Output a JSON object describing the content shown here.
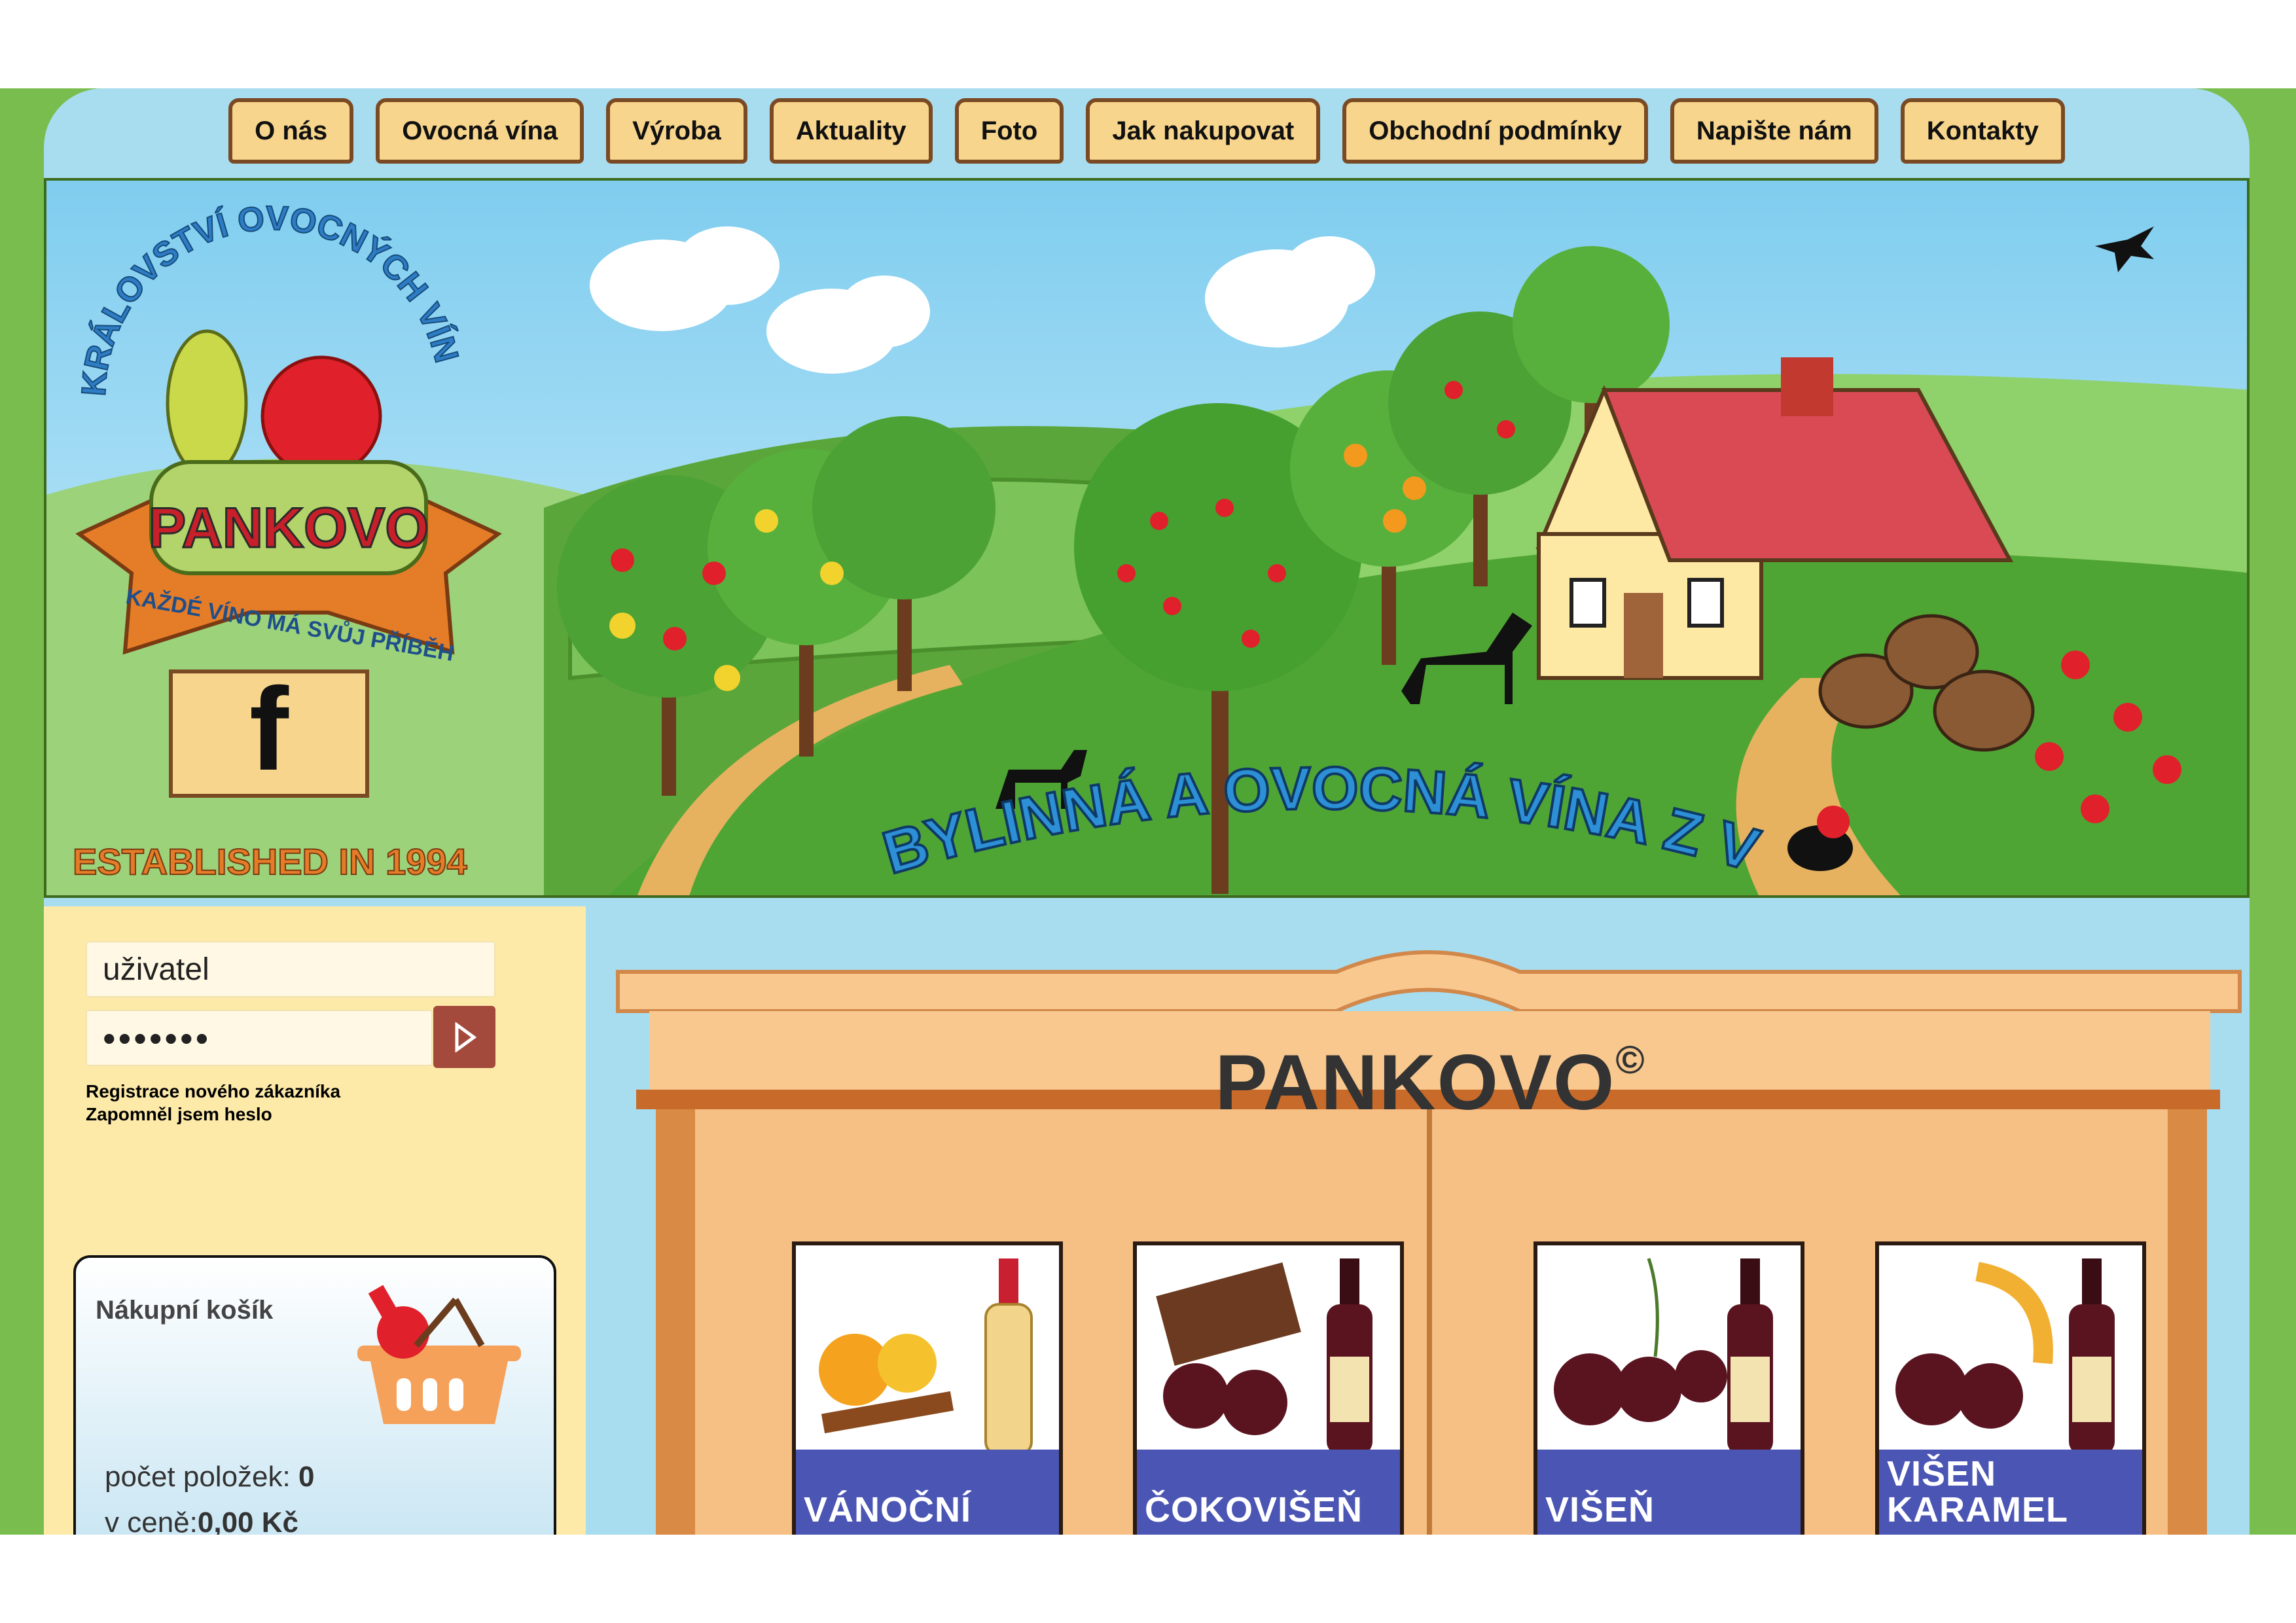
{
  "nav": [
    {
      "label": "O nás"
    },
    {
      "label": "Ovocná vína"
    },
    {
      "label": "Výroba"
    },
    {
      "label": "Aktuality"
    },
    {
      "label": "Foto"
    },
    {
      "label": "Jak nakupovat"
    },
    {
      "label": "Obchodní podmínky"
    },
    {
      "label": "Napište nám"
    },
    {
      "label": "Kontakty"
    }
  ],
  "banner": {
    "logo_arc": "KRÁLOVSTVÍ OVOCNÝCH VÍN",
    "logo_name": "PANKOVO",
    "logo_motto": "KAŽDÉ VÍNO MÁ SVŮJ PŘÍBĚH",
    "established": "ESTABLISHED IN 1994",
    "facebook_icon": "f",
    "headline": "BYLINNÁ A OVOCNÁ VÍNA Z VENKOVA"
  },
  "login": {
    "username_value": "uživatel",
    "password_value": "•••••••",
    "register_link": "Registrace nového zákazníka",
    "forgot_link": "Zapomněl jsem heslo"
  },
  "cart": {
    "title": "Nákupní košík",
    "count_label": "počet položek: ",
    "count_value": "0",
    "price_label": "v ceně:",
    "price_value": "0,00 Kč"
  },
  "shop": {
    "brand": "PANKOVO",
    "copyright": "©"
  },
  "products": [
    {
      "label": "VÁNOČNÍ",
      "wine_color": "#f2d48a"
    },
    {
      "label": "ČOKOVIŠEŇ",
      "wine_color": "#5a1420"
    },
    {
      "label": "VIŠEŇ",
      "wine_color": "#5a1420"
    },
    {
      "label": "VIŠEN\nKARAMEL",
      "wine_color": "#5a1420"
    }
  ],
  "colors": {
    "page_green": "#78bd4e",
    "sky": "#a8dcef",
    "nav_button": "#f8d58c",
    "cart_strip": "#4a55b4",
    "wood": "#f6bf84"
  }
}
